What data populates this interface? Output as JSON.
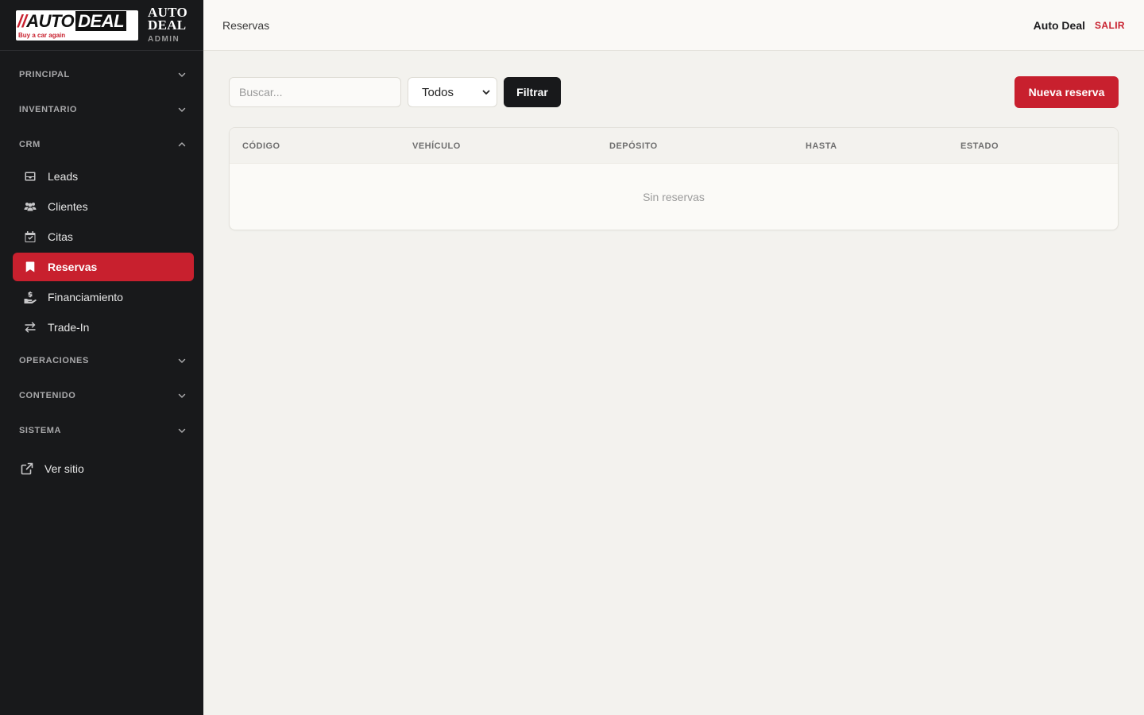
{
  "brand": {
    "logo_slashes": "//",
    "logo_auto": "AUTO",
    "logo_deal": "DEAL",
    "logo_tagline": "Buy a car again",
    "line1": "AUTO",
    "line2": "DEAL",
    "admin_label": "ADMIN"
  },
  "sidebar": {
    "sections": {
      "principal": "PRINCIPAL",
      "inventario": "INVENTARIO",
      "crm": "CRM",
      "operaciones": "OPERACIONES",
      "contenido": "CONTENIDO",
      "sistema": "SISTEMA"
    },
    "crm_items": [
      {
        "label": "Leads",
        "icon": "inbox-icon"
      },
      {
        "label": "Clientes",
        "icon": "users-icon"
      },
      {
        "label": "Citas",
        "icon": "calendar-check-icon"
      },
      {
        "label": "Reservas",
        "icon": "bookmark-icon",
        "active": true
      },
      {
        "label": "Financiamiento",
        "icon": "hand-coin-icon"
      },
      {
        "label": "Trade-In",
        "icon": "exchange-arrows-icon"
      }
    ],
    "view_site": "Ver sitio"
  },
  "topbar": {
    "title": "Reservas",
    "user": "Auto Deal",
    "logout": "SALIR"
  },
  "toolbar": {
    "search_placeholder": "Buscar...",
    "status_selected": "Todos",
    "filter_label": "Filtrar",
    "new_label": "Nueva reserva"
  },
  "table": {
    "columns": [
      "CÓDIGO",
      "VEHÍCULO",
      "DEPÓSITO",
      "HASTA",
      "ESTADO"
    ],
    "empty_text": "Sin reservas"
  },
  "colors": {
    "accent": "#c8202e",
    "sidebar_bg": "#18191b",
    "page_bg": "#f3f2ee"
  }
}
